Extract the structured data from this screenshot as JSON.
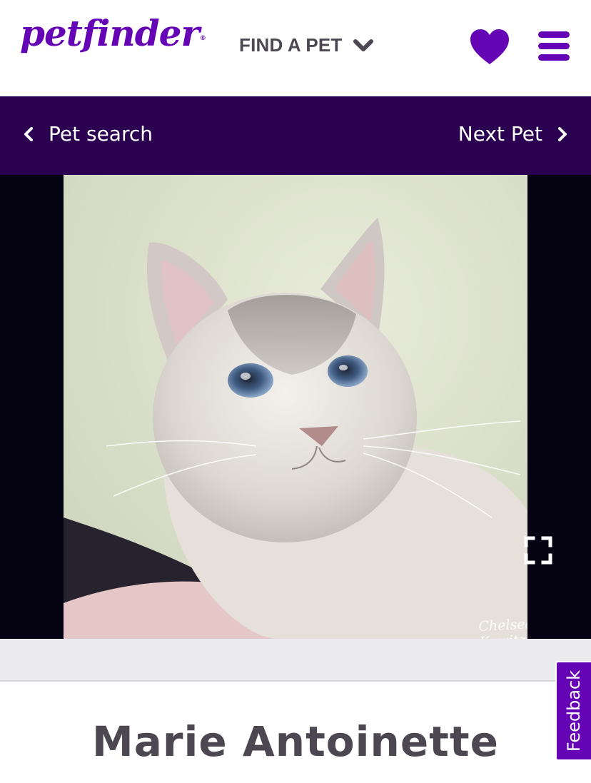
{
  "header": {
    "logo_text": "petfinder",
    "logo_reg_mark": "®",
    "find_pet_label": "FIND A PET",
    "icons": {
      "find_pet_dropdown": "chevron-down-icon",
      "favorites": "heart-icon",
      "menu": "hamburger-menu-icon"
    }
  },
  "nav": {
    "prev_label": "Pet search",
    "next_label": "Next Pet",
    "icons": {
      "prev": "chevron-left-icon",
      "next": "chevron-right-icon"
    }
  },
  "photo": {
    "watermark": "Chelsea Kowitz",
    "fullscreen_icon": "fullscreen-icon"
  },
  "pet": {
    "name": "Marie Antoinette"
  },
  "feedback": {
    "label": "Feedback"
  },
  "colors": {
    "brand_purple": "#6504b5",
    "nav_background": "#2b0051",
    "photo_background": "#050311",
    "text_dark": "#4d4751"
  }
}
